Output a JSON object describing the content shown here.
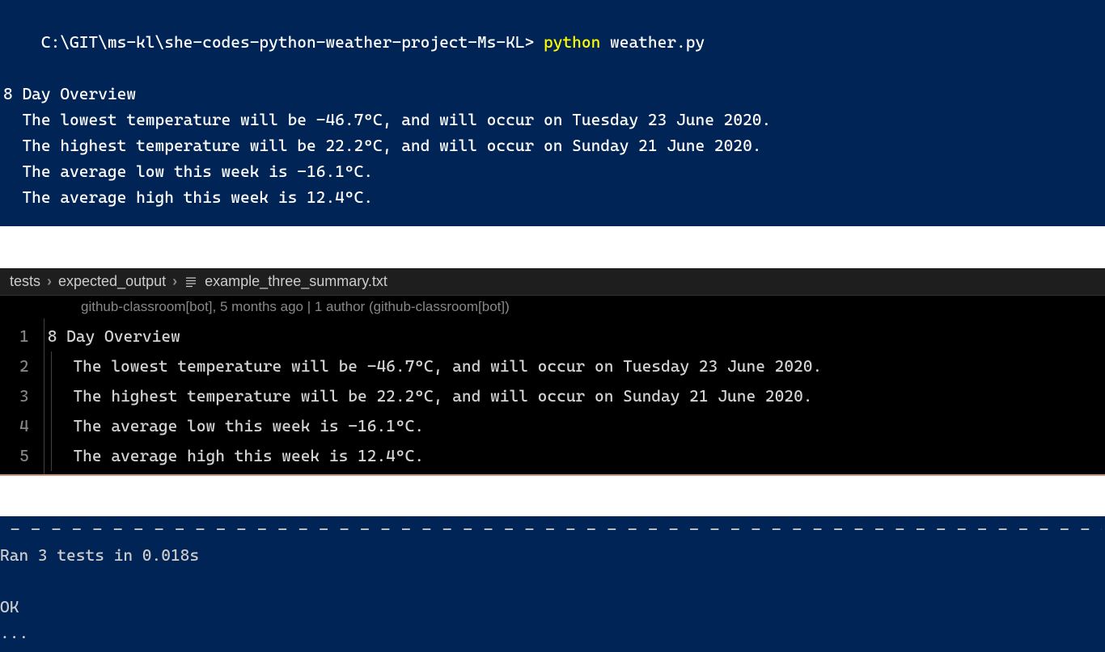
{
  "terminal_top": {
    "prompt_path": "C:\\GIT\\ms-kl\\she-codes-python-weather-project-Ms-KL>",
    "command": "python",
    "arg": "weather.py",
    "output": [
      "8 Day Overview",
      "  The lowest temperature will be -46.7°C, and will occur on Tuesday 23 June 2020.",
      "  The highest temperature will be 22.2°C, and will occur on Sunday 21 June 2020.",
      "  The average low this week is -16.1°C.",
      "  The average high this week is 12.4°C."
    ]
  },
  "breadcrumb": {
    "parts": [
      "tests",
      "expected_output",
      "example_three_summary.txt"
    ]
  },
  "git_info": "github-classroom[bot], 5 months ago | 1 author (github-classroom[bot])",
  "editor": {
    "lines": [
      {
        "num": "1",
        "text": "8 Day Overview",
        "indent": false
      },
      {
        "num": "2",
        "text": " The lowest temperature will be -46.7°C, and will occur on Tuesday 23 June 2020.",
        "indent": true
      },
      {
        "num": "3",
        "text": " The highest temperature will be 22.2°C, and will occur on Sunday 21 June 2020.",
        "indent": true
      },
      {
        "num": "4",
        "text": " The average low this week is -16.1°C.",
        "indent": true
      },
      {
        "num": "5",
        "text": " The average high this week is 12.4°C.",
        "indent": true
      }
    ]
  },
  "terminal_bottom": {
    "dashes": " - - - - - - - - - - - - - - - - - - - - - - - - - - - - - - - - - - - - - - - - - - - - - - - - - - - - - - - - - - - - - - - - - - - - - - - - - - - - - - - - - - - - - - - - - - - - - - - - - - - - - - - - - - - - - -",
    "lines": [
      "Ran 3 tests in 0.018s",
      "",
      "OK",
      "..."
    ]
  }
}
